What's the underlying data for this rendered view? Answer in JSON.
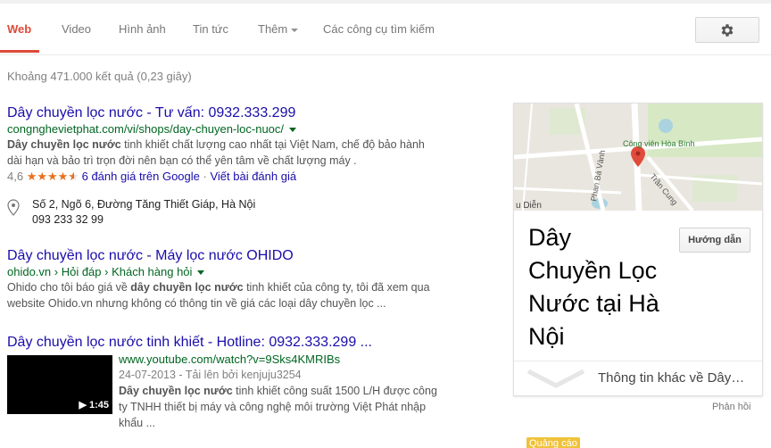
{
  "tabs": {
    "items": [
      {
        "label": "Web",
        "active": true
      },
      {
        "label": "Video"
      },
      {
        "label": "Hình ảnh"
      },
      {
        "label": "Tin tức"
      },
      {
        "label": "Thêm"
      },
      {
        "label": "Các công cụ tìm kiếm"
      }
    ],
    "settings_icon": "gear-icon"
  },
  "stats": "Khoảng 471.000 kết quả (0,23 giây)",
  "results": [
    {
      "title": "Dây chuyền lọc nước - Tư vấn: 0932.333.299",
      "url": "congnghevietphat.com/vi/shops/day-chuyen-loc-nuoc/",
      "snippet_bold": "Dây chuyền lọc nước",
      "snippet_rest_1": " tinh khiết chất lượng cao nhất tại Việt Nam, chế độ bảo hành",
      "snippet_rest_2": "dài hạn và bảo trì trọn đời nên bạn có thể yên tâm về chất lượng máy .",
      "rating_value": "4,6",
      "rating_stars": 4.6,
      "rating_reviews": "6 đánh giá trên Google",
      "rating_sep": " · ",
      "rating_write": "Viết bài đánh giá",
      "address": "Số 2, Ngõ 6, Đường Tăng Thiết Giáp, Hà Nội",
      "phone": "093 233 32 99"
    },
    {
      "title": "Dây chuyền lọc nước - Máy lọc nước OHIDO",
      "url": "ohido.vn › Hỏi đáp › Khách hàng hỏi",
      "snippet_1a": "Ohido cho tôi báo giá về ",
      "snippet_bold": "dây chuyền lọc nước",
      "snippet_1b": " tinh khiết của công ty, tôi đã xem qua",
      "snippet_2": "website Ohido.vn nhưng không có thông tin về giá các loại dây chuyền lọc ..."
    },
    {
      "title": "Dây chuyền lọc nước tinh khiết - Hotline: 0932.333.299 ...",
      "url": "www.youtube.com/watch?v=9Sks4KMRIBs",
      "date": "24-07-2013 - Tải lên bởi kenjuju3254",
      "snippet_bold": "Dây chuyền lọc nước",
      "snippet_rest_1": " tinh khiết công suất 1500 L/H được công",
      "snippet_2": "ty TNHH thiết bị máy và công nghệ môi trường Việt Phát nhập",
      "snippet_3": "khẩu ...",
      "duration": "▶ 1:45"
    }
  ],
  "knowledge_panel": {
    "map_labels": {
      "park": "Công viên Hòa Bình",
      "road1": "Phan Bá Vành",
      "road2": "Trần Cung",
      "area": "u Diễn"
    },
    "title_lines": [
      "Dây",
      "Chuyền Lọc",
      "Nước tại Hà",
      "Nội"
    ],
    "directions_button": "Hướng dẫn",
    "more_info": "Thông tin khác về Dây…"
  },
  "feedback": "Phản hồi",
  "ad_badge": "Quảng cáo",
  "colors": {
    "link": "#1a0dab",
    "url_green": "#006621",
    "active_tab": "#dd4b39",
    "stars": "#e7711b",
    "ad": "#f0c23b"
  }
}
